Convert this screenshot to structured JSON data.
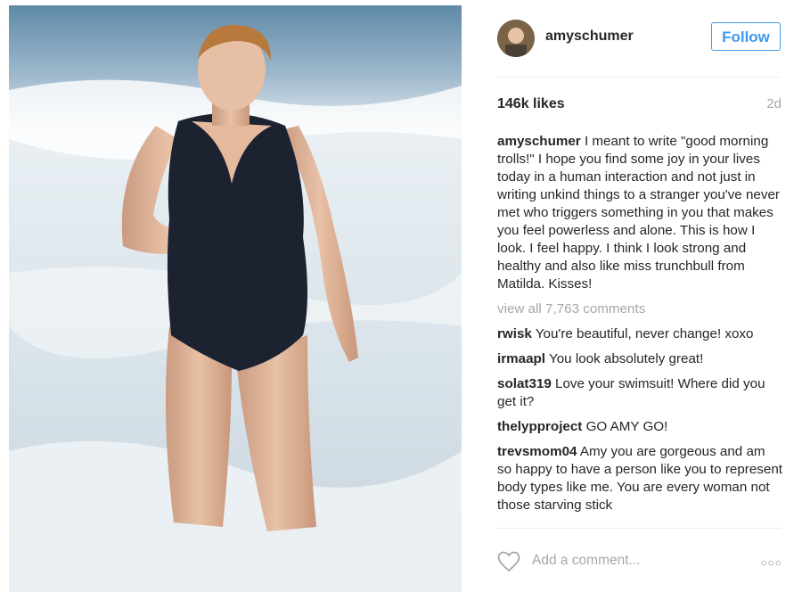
{
  "post": {
    "username": "amyschumer",
    "follow_label": "Follow",
    "likes": "146k likes",
    "age": "2d",
    "caption_user": "amyschumer",
    "caption_text": "I meant to write \"good morning trolls!\" I hope you find some joy in your lives today in a human interaction and not just in writing unkind things to a stranger you've never met who triggers something in you that makes you feel powerless and alone. This is how I look. I feel happy. I think I look strong and healthy and also like miss trunchbull from Matilda. Kisses!",
    "view_all": "view all 7,763 comments"
  },
  "comments": [
    {
      "user": "rwisk",
      "text": "You're beautiful, never change! xoxo"
    },
    {
      "user": "irmaapl",
      "text": "You look absolutely great!"
    },
    {
      "user": "solat319",
      "text": "Love your swimsuit! Where did you get it?"
    },
    {
      "user": "thelypproject",
      "text": "GO AMY GO!"
    },
    {
      "user": "trevsmom04",
      "text": "Amy you are gorgeous and am so happy to have a person like you to represent body types like me. You are every woman not those starving stick"
    }
  ],
  "footer": {
    "add_comment_placeholder": "Add a comment...",
    "more_icon": "more-options-icon",
    "heart_icon": "heart-icon"
  },
  "colors": {
    "accent": "#3f99ed",
    "muted": "#a5a7aa",
    "text": "#262626"
  }
}
